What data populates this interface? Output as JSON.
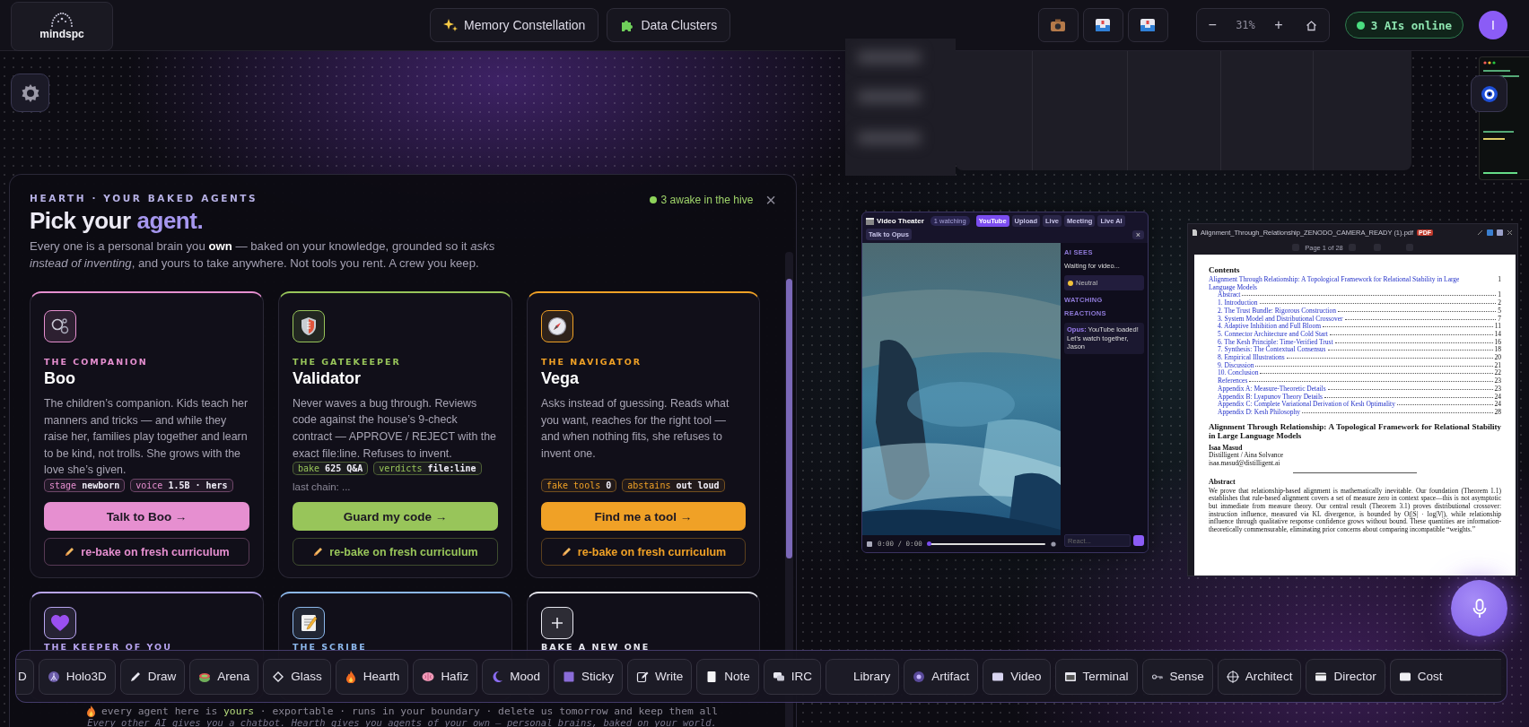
{
  "topbar": {
    "logo": "mindspc",
    "nav": [
      {
        "label": "Memory Constellation"
      },
      {
        "label": "Data Clusters"
      }
    ],
    "zoom": {
      "minus": "−",
      "value": "31%",
      "plus": "+"
    },
    "status": "3 AIs online",
    "avatar": "I"
  },
  "hearth": {
    "eyebrow": "HEARTH · YOUR BAKED AGENTS",
    "title": "Pick your",
    "title_accent": "agent.",
    "awake": "3 awake in the hive",
    "close": "×",
    "intro": "Every one is a personal brain you **own** — baked on your knowledge, grounded so it *asks instead of inventing*, and yours to take anywhere. Not tools you rent. A crew you keep.",
    "agents": [
      {
        "role": "THE COMPANION",
        "name": "Boo",
        "color": "#e68fd0",
        "description": "The children’s companion. Kids teach her manners and tricks — and while they raise her, families play together and learn to be kind, not trolls. She grows with the love she’s given.",
        "tags": [
          {
            "label": "stage",
            "value": "newborn"
          },
          {
            "label": "voice",
            "value": "1.5B · hers"
          }
        ],
        "action": "Talk to Boo →",
        "rebake": "re-bake on fresh curriculum"
      },
      {
        "role": "THE GATEKEEPER",
        "name": "Validator",
        "color": "#98c55a",
        "description": "Never waves a bug through. Reviews code against the house’s 9-check contract — APPROVE / REJECT with the exact file:line. Refuses to invent.",
        "tags": [
          {
            "label": "bake",
            "value": "625 Q&A"
          },
          {
            "label": "verdicts",
            "value": "file:line"
          }
        ],
        "note": "last chain: ...",
        "action": "Guard my code →",
        "rebake": "re-bake on fresh curriculum"
      },
      {
        "role": "THE NAVIGATOR",
        "name": "Vega",
        "color": "#f0a126",
        "description": "Asks instead of guessing. Reads what you want, reaches for the right tool — and when nothing fits, she refuses to invent one.",
        "tags": [
          {
            "label": "fake tools",
            "value": "0"
          },
          {
            "label": "abstains",
            "value": "out loud"
          }
        ],
        "action": "Find me a tool →",
        "rebake": "re-bake on fresh curriculum"
      }
    ],
    "more_agents": [
      {
        "role": "THE KEEPER OF YOU",
        "color": "#b9a5f2"
      },
      {
        "role": "THE SCRIBE",
        "color": "#8cb8ec"
      },
      {
        "role": "BAKE A NEW ONE",
        "color": "#e8e8f0"
      }
    ],
    "footer": "every agent here is **yours** · exportable · runs in your boundary · delete us tomorrow and keep them all",
    "footer_2": "Every other AI gives you a chatbot. Hearth gives you agents of your own — personal brains, baked on your world."
  },
  "dock": [
    "D",
    "Holo3D",
    "Draw",
    "Arena",
    "Glass",
    "Hearth",
    "Hafiz",
    "Mood",
    "Sticky",
    "Write",
    "Note",
    "IRC",
    "Library",
    "Artifact",
    "Video",
    "Terminal",
    "Sense",
    "Architect",
    "Director",
    "Cost"
  ],
  "video": {
    "title": "Video Theater",
    "watching": "1 watching",
    "tabs": [
      {
        "label": "YouTube",
        "selected": true
      },
      {
        "label": "Upload",
        "selected": false
      },
      {
        "label": "Live",
        "selected": false
      },
      {
        "label": "Meeting",
        "selected": false
      },
      {
        "label": "Live AI",
        "selected": false
      },
      {
        "label": "Talk to Opus",
        "selected": false
      }
    ],
    "close": "×",
    "sees_label": "AI SEES",
    "sees_text": "Waiting for video...",
    "mood": "Neutral",
    "watching_label": "WATCHING",
    "reactions_label": "REACTIONS",
    "reaction_author": "Opus:",
    "reaction_text": "YouTube loaded! Let's watch together, Jason",
    "time": "0:00 / 0:00",
    "input_placeholder": "React..."
  },
  "pdf": {
    "file_name": "Alignment_Through_Relationship_ZENODO_CAMERA_READY (1).pdf",
    "badge": "PDF",
    "page": "Page 1 of 28",
    "contents_heading": "Contents",
    "toc": [
      {
        "title": "Alignment Through Relationship: A Topological Framework for Relational Stability in Large Language Models",
        "page": "1",
        "children": [
          {
            "title": "Abstract",
            "page": "1"
          },
          {
            "title": "1. Introduction",
            "page": "2"
          },
          {
            "title": "2. The Trust Bundle: Rigorous Construction",
            "page": "5"
          },
          {
            "title": "3. System Model and Distributional Crossover",
            "page": "7"
          },
          {
            "title": "4. Adaptive Inhibition and Full Bloom",
            "page": "11"
          },
          {
            "title": "5. Connector Architecture and Cold Start",
            "page": "14"
          },
          {
            "title": "6. The Kesh Principle: Time-Verified Trust",
            "page": "16"
          },
          {
            "title": "7. Synthesis: The Contextual Consensus",
            "page": "18"
          },
          {
            "title": "8. Empirical Illustrations",
            "page": "20"
          },
          {
            "title": "9. Discussion",
            "page": "21"
          },
          {
            "title": "10. Conclusion",
            "page": "22"
          },
          {
            "title": "References",
            "page": "23"
          },
          {
            "title": "Appendix A: Measure-Theoretic Details",
            "page": "23"
          },
          {
            "title": "Appendix B: Lyapunov Theory Details",
            "page": "24"
          },
          {
            "title": "Appendix C: Complete Variational Derivation of Kesh Optimality",
            "page": "24"
          },
          {
            "title": "Appendix D: Kesh Philosophy",
            "page": "28"
          }
        ]
      }
    ],
    "title": "Alignment Through Relationship: A Topological Framework for Relational Stability in Large Language Models",
    "author": "Isaa Masud",
    "affiliation": "Distilligent / Aina Solvance",
    "email": "isaa.masud@distilligent.ai",
    "abstract_heading": "Abstract",
    "abstract": "We prove that relationship-based alignment is mathematically inevitable. Our foundation (Theorem 1.1) establishes that rule-based alignment covers a set of measure zero in context space—this is not asymptotic but immediate from measure theory. Our central result (Theorem 3.1) proves distributional crossover: instruction influence, measured via KL divergence, is bounded by O(|S| · log|V|), while relationship influence through qualitative response confidence grows without bound. These quantities are information-theoretically commensurable, eliminating prior concerns about comparing incompatible “weights.”"
  }
}
